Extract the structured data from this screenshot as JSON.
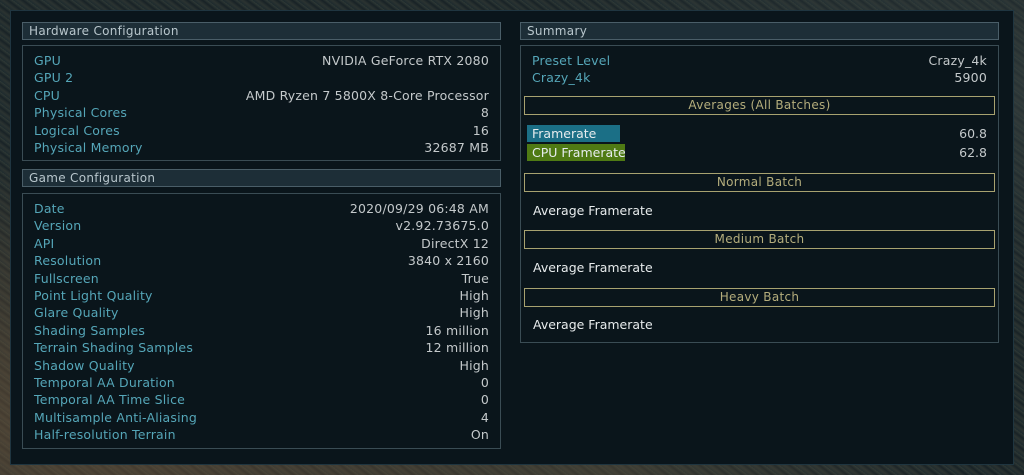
{
  "hardware": {
    "header": "Hardware Configuration",
    "rows": [
      {
        "label": "GPU",
        "value": "NVIDIA GeForce RTX 2080"
      },
      {
        "label": "GPU 2",
        "value": ""
      },
      {
        "label": "CPU",
        "value": "AMD Ryzen 7 5800X 8-Core Processor"
      },
      {
        "label": "Physical Cores",
        "value": "8"
      },
      {
        "label": "Logical Cores",
        "value": "16"
      },
      {
        "label": "Physical Memory",
        "value": "32687 MB"
      }
    ]
  },
  "game": {
    "header": "Game Configuration",
    "rows": [
      {
        "label": "Date",
        "value": "2020/09/29 06:48 AM"
      },
      {
        "label": "Version",
        "value": "v2.92.73675.0"
      },
      {
        "label": "API",
        "value": "DirectX 12"
      },
      {
        "label": "Resolution",
        "value": "3840 x 2160"
      },
      {
        "label": "Fullscreen",
        "value": "True"
      },
      {
        "label": "Point Light Quality",
        "value": "High"
      },
      {
        "label": "Glare Quality",
        "value": "High"
      },
      {
        "label": "Shading Samples",
        "value": "16 million"
      },
      {
        "label": "Terrain Shading Samples",
        "value": "12 million"
      },
      {
        "label": "Shadow Quality",
        "value": "High"
      },
      {
        "label": "Temporal AA Duration",
        "value": "0"
      },
      {
        "label": "Temporal AA Time Slice",
        "value": "0"
      },
      {
        "label": "Multisample Anti-Aliasing",
        "value": "4"
      },
      {
        "label": "Half-resolution Terrain",
        "value": "On"
      }
    ]
  },
  "summary": {
    "header": "Summary",
    "rows": [
      {
        "label": "Preset Level",
        "value": "Crazy_4k"
      },
      {
        "label": "Crazy_4k",
        "value": "5900"
      }
    ],
    "averages_header": "Averages (All Batches)",
    "framerate_label": "Framerate",
    "framerate_value": "60.8",
    "cpu_framerate_label": "CPU Framerate",
    "cpu_framerate_value": "62.8",
    "normal_batch": "Normal Batch",
    "normal_avg_label": "Average Framerate",
    "medium_batch": "Medium Batch",
    "medium_avg_label": "Average Framerate",
    "heavy_batch": "Heavy Batch",
    "heavy_avg_label": "Average Framerate"
  },
  "colors": {
    "label_teal": "#55a6b8",
    "value_grey": "#c4c9cb",
    "framerate_bar": "#1b6f86",
    "cpu_framerate_bar": "#4f7a14",
    "batch_border": "#a8a270"
  }
}
